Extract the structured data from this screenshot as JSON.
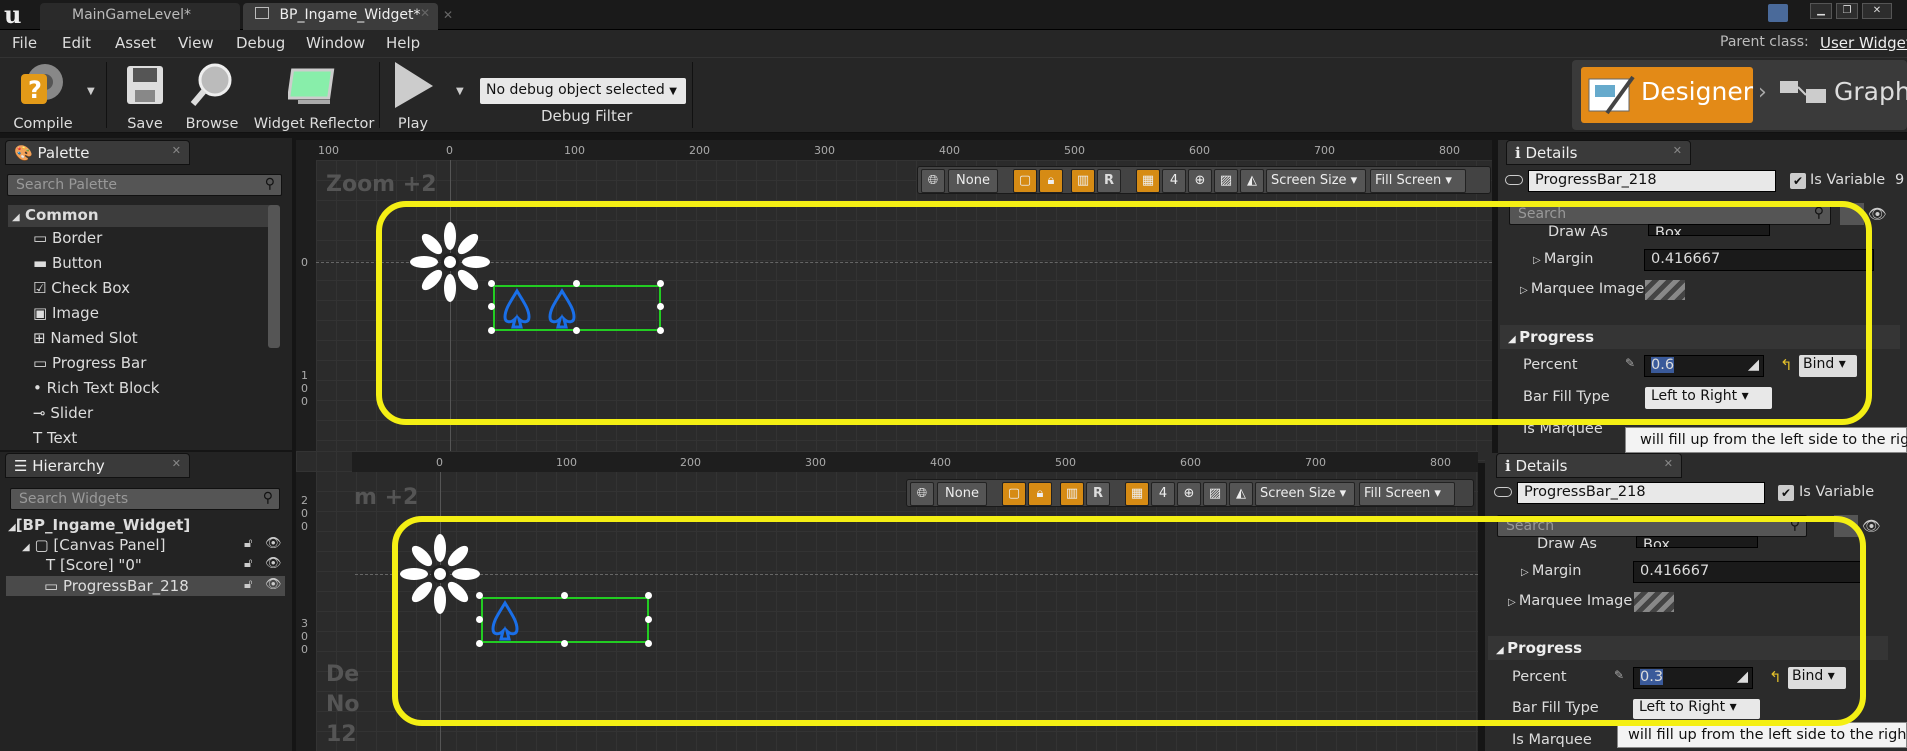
{
  "tabs": [
    {
      "label": "MainGameLevel*"
    },
    {
      "label": "BP_Ingame_Widget*"
    }
  ],
  "menu": [
    "File",
    "Edit",
    "Asset",
    "View",
    "Debug",
    "Window",
    "Help"
  ],
  "parent_class": {
    "label": "Parent class:",
    "value": "User Widget"
  },
  "toolbar": {
    "compile": "Compile",
    "save": "Save",
    "browse": "Browse",
    "reflector": "Widget Reflector",
    "play": "Play",
    "debug_select": "No debug object selected",
    "debug_filter": "Debug Filter"
  },
  "mode": {
    "designer": "Designer",
    "graph": "Graph"
  },
  "palette": {
    "title": "Palette",
    "search": "Search Palette",
    "category": "Common",
    "items": [
      "Border",
      "Button",
      "Check Box",
      "Image",
      "Named Slot",
      "Progress Bar",
      "Rich Text Block",
      "Slider",
      "Text"
    ]
  },
  "hierarchy": {
    "title": "Hierarchy",
    "search": "Search Widgets",
    "root": "[BP_Ingame_Widget]",
    "canvas": "[Canvas Panel]",
    "score": "[Score] \"0\"",
    "progress": "ProgressBar_218"
  },
  "view1": {
    "zoom": "Zoom +2",
    "ticks": [
      "100",
      "0",
      "100",
      "200",
      "300",
      "400",
      "500",
      "600",
      "700",
      "800"
    ],
    "vticks": [
      "0",
      "1",
      "0",
      "0"
    ],
    "none": "None",
    "grid": "4",
    "r": "R",
    "screen_size": "Screen Size",
    "fill_screen": "Fill Screen",
    "fill_percent": 0.6
  },
  "view2": {
    "zoom": "m +2",
    "ticks": [
      "0",
      "100",
      "200",
      "300",
      "400",
      "500",
      "600",
      "700",
      "800"
    ],
    "vticks": [
      "2",
      "0",
      "0",
      "3",
      "0",
      "0"
    ],
    "none": "None",
    "grid": "4",
    "r": "R",
    "screen_size": "Screen Size",
    "fill_screen": "Fill Screen",
    "overlay": [
      "De",
      "No",
      "12"
    ],
    "fill_percent": 0.3
  },
  "details1": {
    "title": "Details",
    "name": "ProgressBar_218",
    "is_variable": "Is Variable",
    "search": "Search",
    "draw_as": "Draw As",
    "draw_as_val": "Box",
    "margin": "Margin",
    "margin_val": "0.416667",
    "marquee_image": "Marquee Image",
    "progress": "Progress",
    "percent": "Percent",
    "percent_val": "0.6",
    "bind": "Bind",
    "bar_fill_type": "Bar Fill Type",
    "fill_val": "Left to Right",
    "is_marquee": "Is Marquee",
    "tooltip": "will fill up from the left side to the right",
    "cut": "9"
  },
  "details2": {
    "title": "Details",
    "name": "ProgressBar_218",
    "is_variable": "Is Variable",
    "search": "Search",
    "draw_as": "Draw As",
    "draw_as_val": "Box",
    "margin": "Margin",
    "margin_val": "0.416667",
    "marquee_image": "Marquee Image",
    "progress": "Progress",
    "percent": "Percent",
    "percent_val": "0.3",
    "bind": "Bind",
    "bar_fill_type": "Bar Fill Type",
    "fill_val": "Left to Right",
    "is_marquee": "Is Marquee",
    "tooltip": "will fill up from the left side to the right"
  },
  "colors": {
    "highlight": "#f4ef14",
    "accent": "#d68b14",
    "selection": "#22cc22",
    "icon_blue": "#1a6fe8"
  }
}
